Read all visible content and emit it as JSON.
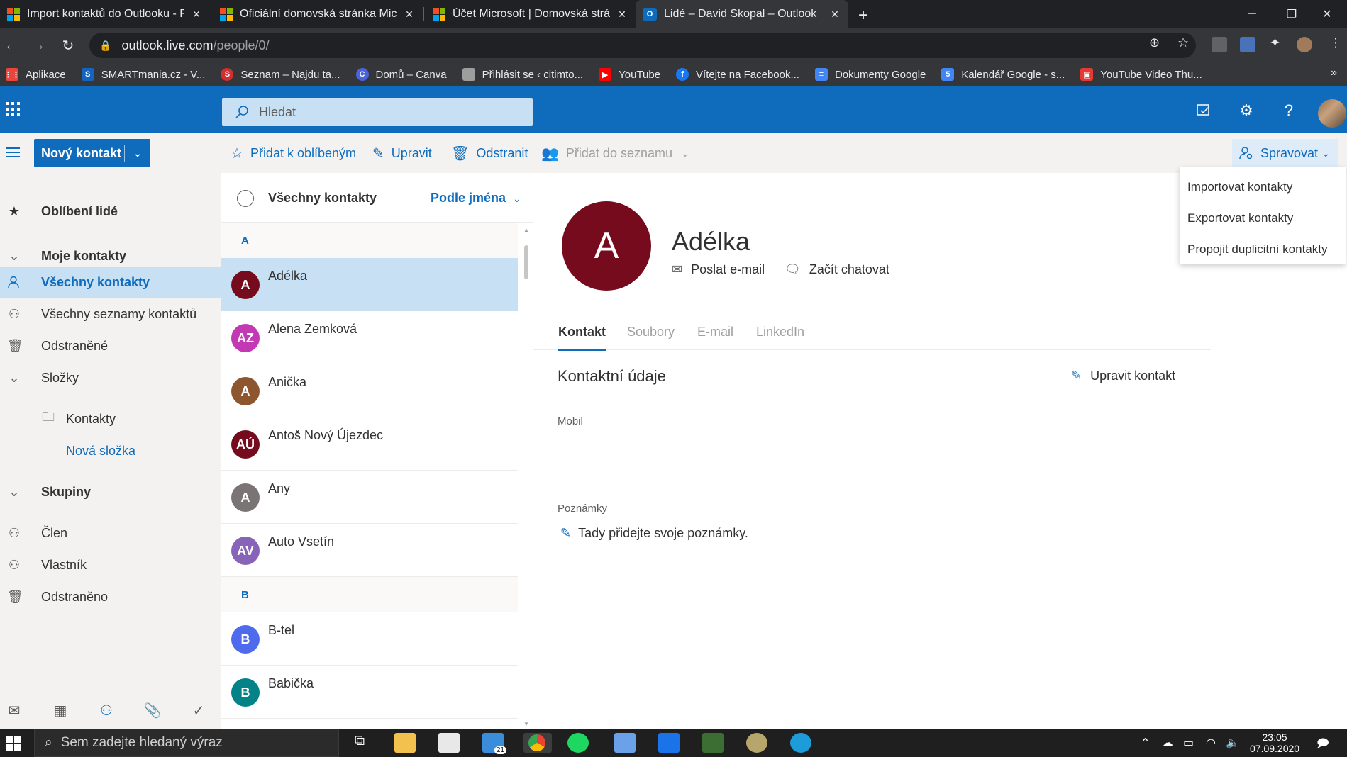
{
  "browser": {
    "tabs": [
      {
        "title": "Import kontaktů do Outlooku - P",
        "icon": "microsoft-logo-icon"
      },
      {
        "title": "Oficiální domovská stránka Micro",
        "icon": "microsoft-logo-icon"
      },
      {
        "title": "Účet Microsoft | Domovská strán",
        "icon": "microsoft-logo-icon"
      },
      {
        "title": "Lidé – David Skopal – Outlook",
        "icon": "outlook-icon"
      }
    ],
    "url_host": "outlook.live.com",
    "url_path": "/people/0/",
    "bookmarks": [
      {
        "label": "Aplikace",
        "color": "#e8453c"
      },
      {
        "label": "SMARTmania.cz - V...",
        "color": "#1565c0"
      },
      {
        "label": "Seznam – Najdu ta...",
        "color": "#d32f2f"
      },
      {
        "label": "Domů – Canva",
        "color": "#4a63d8"
      },
      {
        "label": "Přihlásit se ‹ citimto...",
        "color": "#9e9e9e"
      },
      {
        "label": "YouTube",
        "color": "#ff0000"
      },
      {
        "label": "Vítejte na Facebook...",
        "color": "#1877f2"
      },
      {
        "label": "Dokumenty Google",
        "color": "#4285f4"
      },
      {
        "label": "Kalendář Google - s...",
        "color": "#4285f4"
      },
      {
        "label": "YouTube Video Thu...",
        "color": "#e53935"
      }
    ]
  },
  "header": {
    "search_placeholder": "Hledat"
  },
  "commands": {
    "new_contact": "Nový kontakt",
    "add_favorite": "Přidat k oblíbeným",
    "edit": "Upravit",
    "delete": "Odstranit",
    "add_to_list": "Přidat do seznamu",
    "manage": "Spravovat"
  },
  "manage_menu": {
    "items": [
      "Importovat kontakty",
      "Exportovat kontakty",
      "Propojit duplicitní kontakty"
    ]
  },
  "leftnav": {
    "favorites": "Oblíbení lidé",
    "my_contacts": "Moje kontakty",
    "all_contacts": "Všechny kontakty",
    "all_lists": "Všechny seznamy kontaktů",
    "deleted": "Odstraněné",
    "folders": "Složky",
    "contacts_folder": "Kontakty",
    "new_folder": "Nová složka",
    "groups": "Skupiny",
    "member": "Člen",
    "owner": "Vlastník",
    "removed": "Odstraněno"
  },
  "list": {
    "title": "Všechny kontakty",
    "sort": "Podle jména",
    "letters": [
      "A",
      "B"
    ],
    "contacts": [
      {
        "initials": "A",
        "name": "Adélka",
        "color": "#750b1c"
      },
      {
        "initials": "AZ",
        "name": "Alena Zemková",
        "color": "#c239b3"
      },
      {
        "initials": "A",
        "name": "Anička",
        "color": "#8e562e"
      },
      {
        "initials": "AÚ",
        "name": "Antoš Nový Újezdec",
        "color": "#750b1c"
      },
      {
        "initials": "A",
        "name": "Any",
        "color": "#7a7574"
      },
      {
        "initials": "AV",
        "name": "Auto Vsetín",
        "color": "#8764b8"
      },
      {
        "initials": "B",
        "name": "B-tel",
        "color": "#4f6bed"
      },
      {
        "initials": "B",
        "name": "Babička",
        "color": "#038387"
      }
    ]
  },
  "detail": {
    "initial": "A",
    "name": "Adélka",
    "send_email": "Poslat e-mail",
    "start_chat": "Začít chatovat",
    "tabs": [
      "Kontakt",
      "Soubory",
      "E-mail",
      "LinkedIn"
    ],
    "section_title": "Kontaktní údaje",
    "edit_contact": "Upravit kontakt",
    "mobile_label": "Mobil",
    "notes_label": "Poznámky",
    "notes_placeholder": "Tady přidejte svoje poznámky."
  },
  "taskbar": {
    "search_placeholder": "Sem zadejte hledaný výraz",
    "mail_badge": "21",
    "time": "23:05",
    "date": "07.09.2020"
  }
}
